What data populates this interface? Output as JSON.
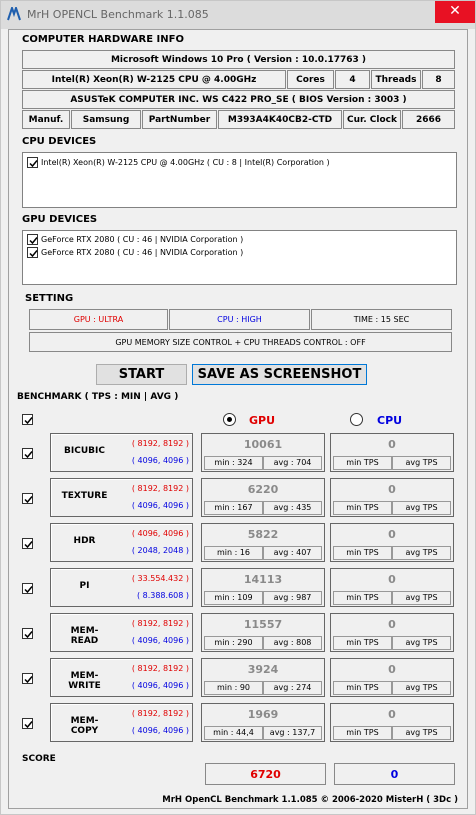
{
  "window": {
    "title": "MrH OPENCL Benchmark 1.1.085",
    "close_glyph": "✕"
  },
  "hardware": {
    "heading": "COMPUTER HARDWARE INFO",
    "os": "Microsoft Windows 10 Pro ( Version : 10.0.17763 )",
    "cpu": "Intel(R) Xeon(R) W-2125 CPU @ 4.00GHz",
    "cores_label": "Cores",
    "cores": "4",
    "threads_label": "Threads",
    "threads": "8",
    "board": "ASUSTeK COMPUTER INC. WS C422 PRO_SE ( BIOS Version : 3003 )",
    "manuf_label": "Manuf.",
    "manuf": "Samsung",
    "part_label": "PartNumber",
    "part": "M393A4K40CB2-CTD",
    "clock_label": "Cur. Clock",
    "clock": "2666"
  },
  "cpu_devices": {
    "heading": "CPU DEVICES",
    "items": [
      "Intel(R) Xeon(R) W-2125 CPU @ 4.00GHz ( CU : 8 | Intel(R) Corporation )"
    ]
  },
  "gpu_devices": {
    "heading": "GPU DEVICES",
    "items": [
      "GeForce RTX 2080 ( CU : 46 | NVIDIA Corporation )",
      "GeForce RTX 2080 ( CU : 46 | NVIDIA Corporation )"
    ]
  },
  "setting": {
    "heading": "SETTING",
    "gpu": "GPU : ULTRA",
    "cpu": "CPU : HIGH",
    "time": "TIME : 15 SEC",
    "memory": "GPU MEMORY SIZE CONTROL + CPU THREADS CONTROL : OFF"
  },
  "buttons": {
    "start": "START",
    "screenshot": "SAVE AS SCREENSHOT"
  },
  "benchmark": {
    "heading": "BENCHMARK ( TPS : MIN | AVG )",
    "gpu_label": "GPU",
    "cpu_label": "CPU",
    "selected": "GPU",
    "rows": [
      {
        "name": "BICUBIC",
        "res_gpu": "( 8192, 8192 )",
        "res_cpu": "( 4096, 4096 )",
        "gpu_score": "10061",
        "gpu_min": "min : 324",
        "gpu_avg": "avg : 704",
        "cpu_score": "0",
        "cpu_min": "min TPS",
        "cpu_avg": "avg TPS"
      },
      {
        "name": "TEXTURE",
        "res_gpu": "( 8192, 8192 )",
        "res_cpu": "( 4096, 4096 )",
        "gpu_score": "6220",
        "gpu_min": "min : 167",
        "gpu_avg": "avg : 435",
        "cpu_score": "0",
        "cpu_min": "min TPS",
        "cpu_avg": "avg TPS"
      },
      {
        "name": "HDR",
        "res_gpu": "( 4096, 4096 )",
        "res_cpu": "( 2048, 2048 )",
        "gpu_score": "5822",
        "gpu_min": "min : 16",
        "gpu_avg": "avg : 407",
        "cpu_score": "0",
        "cpu_min": "min TPS",
        "cpu_avg": "avg TPS"
      },
      {
        "name": "PI",
        "res_gpu": "( 33.554.432 )",
        "res_cpu": "( 8.388.608 )",
        "gpu_score": "14113",
        "gpu_min": "min : 109",
        "gpu_avg": "avg : 987",
        "cpu_score": "0",
        "cpu_min": "min TPS",
        "cpu_avg": "avg TPS"
      },
      {
        "name": "MEM-READ",
        "res_gpu": "( 8192, 8192 )",
        "res_cpu": "( 4096, 4096 )",
        "gpu_score": "11557",
        "gpu_min": "min : 290",
        "gpu_avg": "avg : 808",
        "cpu_score": "0",
        "cpu_min": "min TPS",
        "cpu_avg": "avg TPS"
      },
      {
        "name": "MEM-WRITE",
        "res_gpu": "( 8192, 8192 )",
        "res_cpu": "( 4096, 4096 )",
        "gpu_score": "3924",
        "gpu_min": "min : 90",
        "gpu_avg": "avg : 274",
        "cpu_score": "0",
        "cpu_min": "min TPS",
        "cpu_avg": "avg TPS"
      },
      {
        "name": "MEM-COPY",
        "res_gpu": "( 8192, 8192 )",
        "res_cpu": "( 4096, 4096 )",
        "gpu_score": "1969",
        "gpu_min": "min : 44,4",
        "gpu_avg": "avg : 137,7",
        "cpu_score": "0",
        "cpu_min": "min TPS",
        "cpu_avg": "avg TPS"
      }
    ]
  },
  "score": {
    "heading": "SCORE",
    "gpu": "6720",
    "cpu": "0"
  },
  "footer": "MrH OpenCL Benchmark 1.1.085  ©  2006-2020 MisterH ( 3Dc )",
  "colors": {
    "gpu": "#e00000",
    "cpu": "#0000e0",
    "close": "#e81123"
  }
}
